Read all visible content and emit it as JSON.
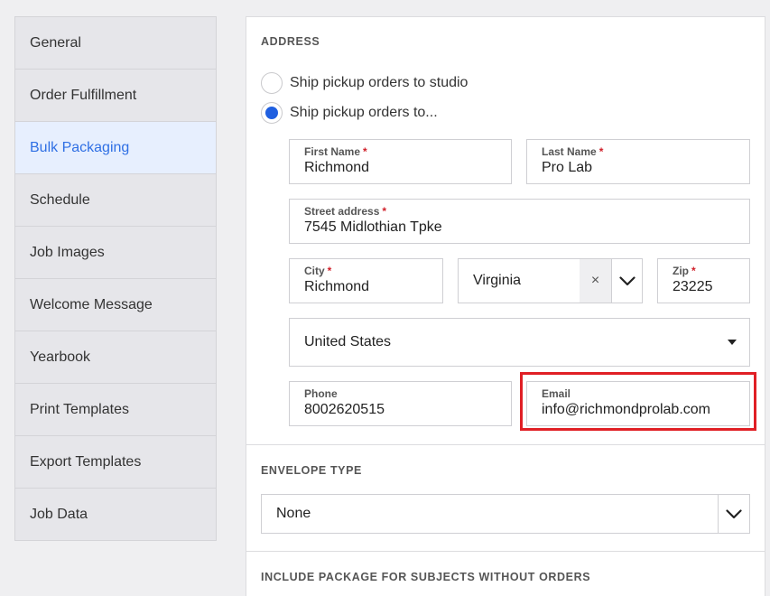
{
  "sidebar": {
    "items": [
      {
        "label": "General"
      },
      {
        "label": "Order Fulfillment"
      },
      {
        "label": "Bulk Packaging"
      },
      {
        "label": "Schedule"
      },
      {
        "label": "Job Images"
      },
      {
        "label": "Welcome Message"
      },
      {
        "label": "Yearbook"
      },
      {
        "label": "Print Templates"
      },
      {
        "label": "Export Templates"
      },
      {
        "label": "Job Data"
      }
    ],
    "active": "Bulk Packaging"
  },
  "address": {
    "title": "ADDRESS",
    "options": [
      {
        "label": "Ship pickup orders to studio",
        "checked": false
      },
      {
        "label": "Ship pickup orders to...",
        "checked": true
      }
    ],
    "first_name": {
      "label": "First Name",
      "value": "Richmond"
    },
    "last_name": {
      "label": "Last Name",
      "value": "Pro Lab"
    },
    "street": {
      "label": "Street address",
      "value": "7545 Midlothian Tpke"
    },
    "city": {
      "label": "City",
      "value": "Richmond"
    },
    "state": {
      "value": "Virginia",
      "clear_glyph": "×"
    },
    "zip": {
      "label": "Zip",
      "value": "23225"
    },
    "country": {
      "value": "United States"
    },
    "phone": {
      "label": "Phone",
      "value": "8002620515"
    },
    "email": {
      "label": "Email",
      "value": "info@richmondprolab.com"
    },
    "required_marker": "*"
  },
  "envelope": {
    "title": "ENVELOPE TYPE",
    "value": "None"
  },
  "include_package": {
    "title": "INCLUDE PACKAGE FOR SUBJECTS WITHOUT ORDERS"
  },
  "colors": {
    "accent": "#1f5fe0",
    "active_bg": "#e7effe",
    "highlight": "#e01f25",
    "required": "#d0202a"
  }
}
